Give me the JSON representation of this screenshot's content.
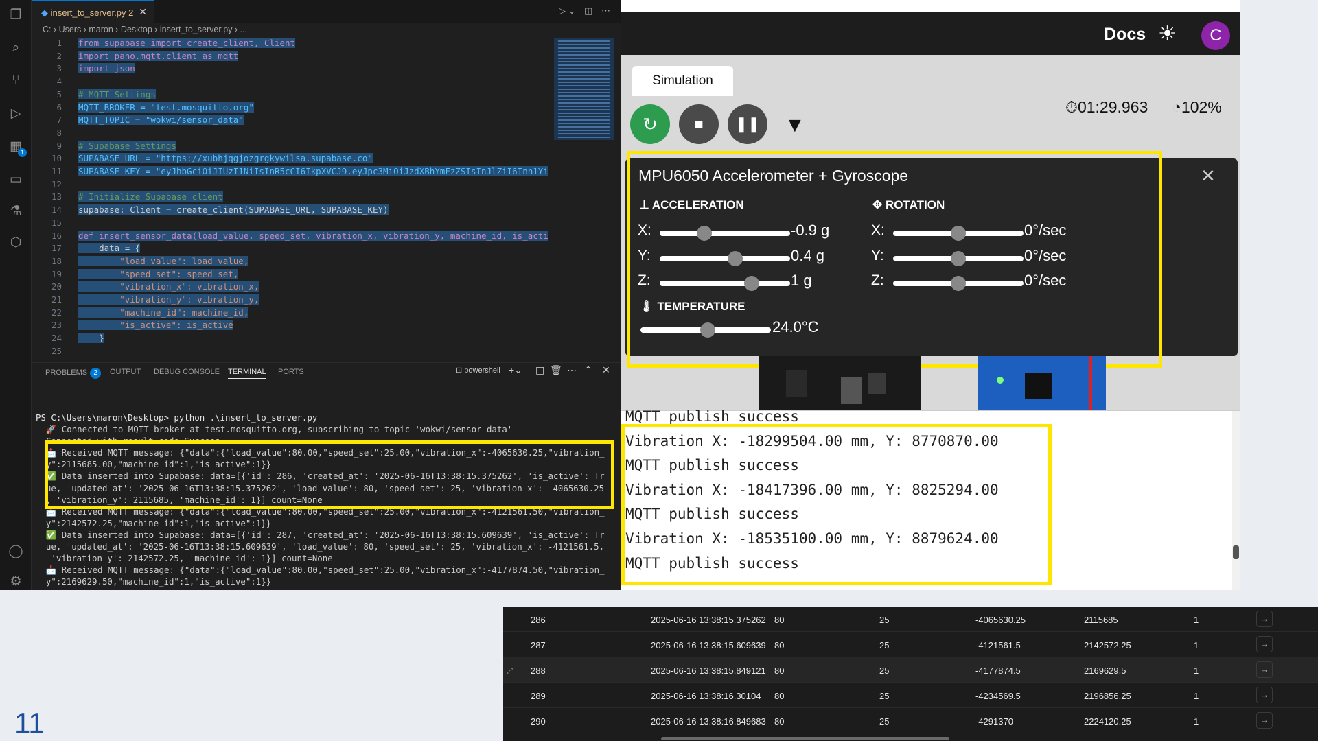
{
  "vscode": {
    "tab_title": "insert_to_server.py 2",
    "breadcrumb": [
      "C:",
      "Users",
      "maron",
      "Desktop",
      "insert_to_server.py",
      "..."
    ],
    "code_lines": [
      [
        "1",
        "from supabase import create_client, Client"
      ],
      [
        "2",
        "import paho.mqtt.client as mqtt"
      ],
      [
        "3",
        "import json"
      ],
      [
        "4",
        ""
      ],
      [
        "5",
        "# MQTT Settings"
      ],
      [
        "6",
        "MQTT_BROKER = \"test.mosquitto.org\""
      ],
      [
        "7",
        "MQTT_TOPIC = \"wokwi/sensor_data\""
      ],
      [
        "8",
        ""
      ],
      [
        "9",
        "# Supabase Settings"
      ],
      [
        "10",
        "SUPABASE_URL = \"https://xubhjqgjozgrgkywilsa.supabase.co\""
      ],
      [
        "11",
        "SUPABASE_KEY = \"eyJhbGciOiJIUzI1NiIsInR5cCI6IkpXVCJ9.eyJpc3MiOiJzdXBhYmFzZSIsInJlZiI6Inh1Yi"
      ],
      [
        "12",
        ""
      ],
      [
        "13",
        "# Initialize Supabase client"
      ],
      [
        "14",
        "supabase: Client = create_client(SUPABASE_URL, SUPABASE_KEY)"
      ],
      [
        "15",
        ""
      ],
      [
        "16",
        "def insert_sensor_data(load_value, speed_set, vibration_x, vibration_y, machine_id, is_acti"
      ],
      [
        "17",
        "    data = {"
      ],
      [
        "18",
        "        \"load_value\": load_value,"
      ],
      [
        "19",
        "        \"speed_set\": speed_set,"
      ],
      [
        "20",
        "        \"vibration_x\": vibration_x,"
      ],
      [
        "21",
        "        \"vibration_y\": vibration_y,"
      ],
      [
        "22",
        "        \"machine_id\": machine_id,"
      ],
      [
        "23",
        "        \"is_active\": is_active"
      ],
      [
        "24",
        "    }"
      ],
      [
        "25",
        ""
      ]
    ],
    "panel_tabs": {
      "problems": "PROBLEMS",
      "problems_count": "2",
      "output": "OUTPUT",
      "debug": "DEBUG CONSOLE",
      "terminal": "TERMINAL",
      "ports": "PORTS"
    },
    "shell": "powershell",
    "terminal_lines": [
      "PS C:\\Users\\maron\\Desktop> python .\\insert_to_server.py",
      "  🚀 Connected to MQTT broker at test.mosquitto.org, subscribing to topic 'wokwi/sensor_data'",
      "  Connected with result code Success",
      "  📩 Received MQTT message: {\"data\":{\"load_value\":80.00,\"speed_set\":25.00,\"vibration_x\":-4065630.25,\"vibration_",
      "  y\":2115685.00,\"machine_id\":1,\"is_active\":1}}",
      "  ✅ Data inserted into Supabase: data=[{'id': 286, 'created_at': '2025-06-16T13:38:15.375262', 'is_active': Tr",
      "  ue, 'updated_at': '2025-06-16T13:38:15.375262', 'load_value': 80, 'speed_set': 25, 'vibration_x': -4065630.25",
      "  , 'vibration_y': 2115685, 'machine_id': 1}] count=None",
      "  📩 Received MQTT message: {\"data\":{\"load_value\":80.00,\"speed_set\":25.00,\"vibration_x\":-4121561.50,\"vibration_",
      "  y\":2142572.25,\"machine_id\":1,\"is_active\":1}}",
      "  ✅ Data inserted into Supabase: data=[{'id': 287, 'created_at': '2025-06-16T13:38:15.609639', 'is_active': Tr",
      "  ue, 'updated_at': '2025-06-16T13:38:15.609639', 'load_value': 80, 'speed_set': 25, 'vibration_x': -4121561.5,",
      "   'vibration_y': 2142572.25, 'machine_id': 1}] count=None",
      "  📩 Received MQTT message: {\"data\":{\"load_value\":80.00,\"speed_set\":25.00,\"vibration_x\":-4177874.50,\"vibration_",
      "  y\":2169629.50,\"machine_id\":1,\"is_active\":1}}"
    ]
  },
  "wokwi": {
    "docs": "Docs",
    "avatar": "C",
    "sim_tab": "Simulation",
    "timer": "01:29.963",
    "speed": "102%",
    "mpu_title": "MPU6050 Accelerometer + Gyroscope",
    "accel_label": "ACCELERATION",
    "rotation_label": "ROTATION",
    "temp_label": "TEMPERATURE",
    "accel": [
      {
        "axis": "X:",
        "value": "-0.9 g",
        "level": 0.32
      },
      {
        "axis": "Y:",
        "value": "0.4 g",
        "level": 0.59
      },
      {
        "axis": "Z:",
        "value": "1 g",
        "level": 0.73
      }
    ],
    "rotation": [
      {
        "axis": "X:",
        "value": "0°/sec",
        "level": 0.5
      },
      {
        "axis": "Y:",
        "value": "0°/sec",
        "level": 0.5
      },
      {
        "axis": "Z:",
        "value": "0°/sec",
        "level": 0.5
      }
    ],
    "temperature": {
      "value": "24.0°C",
      "level": 0.52
    },
    "serial_lines": [
      "MQTT publish success",
      "Vibration X: -18299504.00 mm, Y: 8770870.00",
      "MQTT publish success",
      "Vibration X: -18417396.00 mm, Y: 8825294.00",
      "MQTT publish success",
      "Vibration X: -18535100.00 mm, Y: 8879624.00",
      "MQTT publish success"
    ]
  },
  "table_rows": [
    [
      "286",
      "2025-06-16 13:38:15.375262",
      "80",
      "25",
      "-4065630.25",
      "2115685",
      "1"
    ],
    [
      "287",
      "2025-06-16 13:38:15.609639",
      "80",
      "25",
      "-4121561.5",
      "2142572.25",
      "1"
    ],
    [
      "288",
      "2025-06-16 13:38:15.849121",
      "80",
      "25",
      "-4177874.5",
      "2169629.5",
      "1"
    ],
    [
      "289",
      "2025-06-16 13:38:16.30104",
      "80",
      "25",
      "-4234569.5",
      "2196856.25",
      "1"
    ],
    [
      "290",
      "2025-06-16 13:38:16.849683",
      "80",
      "25",
      "-4291370",
      "2224120.25",
      "1"
    ]
  ],
  "slide_number": "11",
  "colors": {
    "highlight": "#ffe600",
    "accent": "#0078d4",
    "avatar": "#8e24aa",
    "restart": "#2e9c4e"
  }
}
